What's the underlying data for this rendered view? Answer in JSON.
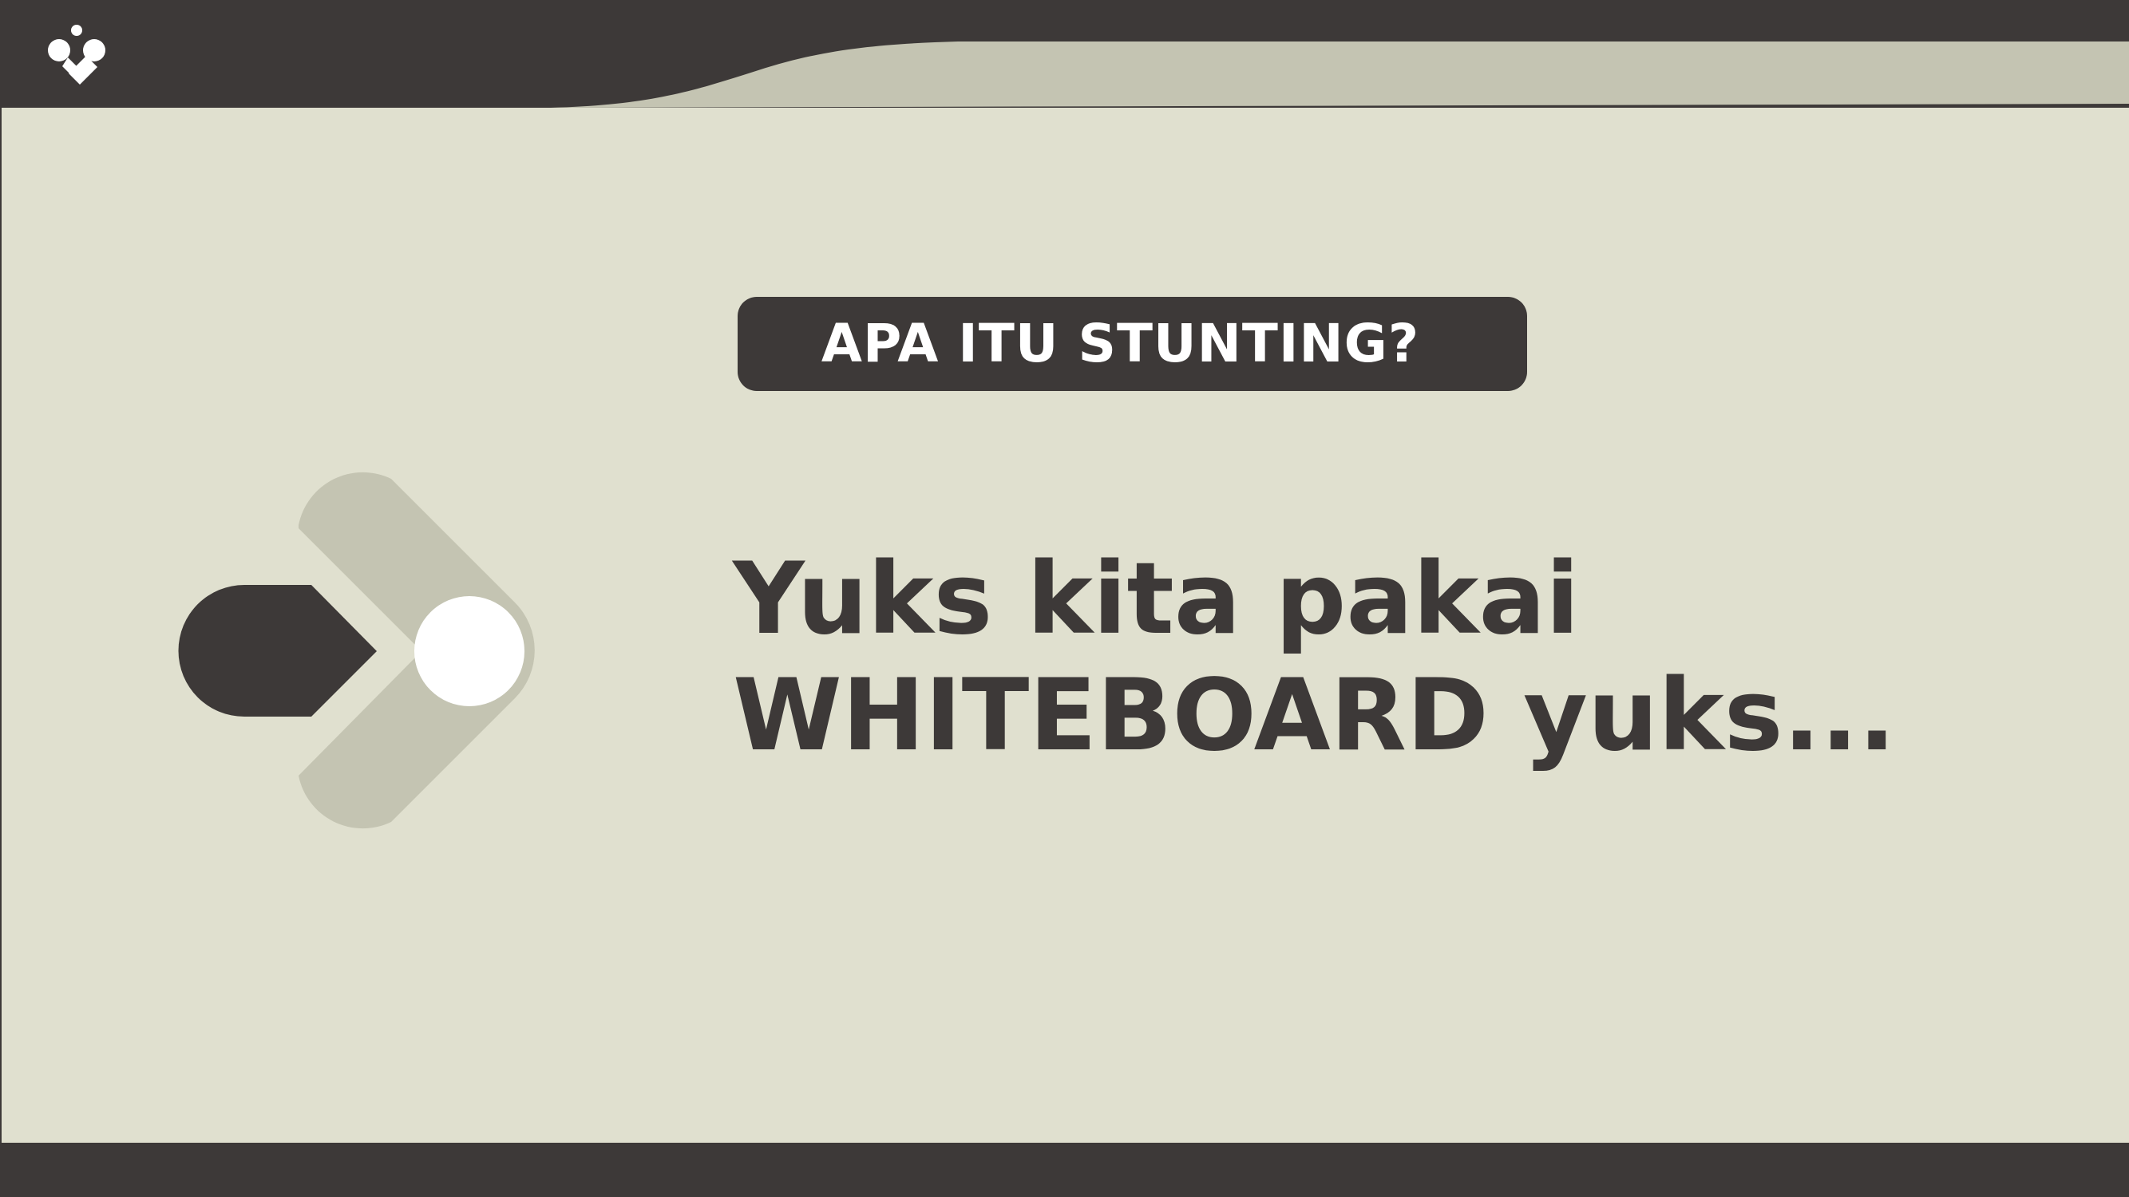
{
  "slide": {
    "title_badge": "APA ITU STUNTING?",
    "body_line_1": "Yuks kita pakai",
    "body_line_2": "WHITEBOARD yuks..."
  },
  "icons": {
    "logo": "brand-logo-icon",
    "decoration": "arrow-chevron-graphic-icon"
  },
  "colors": {
    "dark": "#3d3938",
    "background": "#e0e0cf",
    "accent_light": "#c4c4b2",
    "white": "#ffffff"
  }
}
